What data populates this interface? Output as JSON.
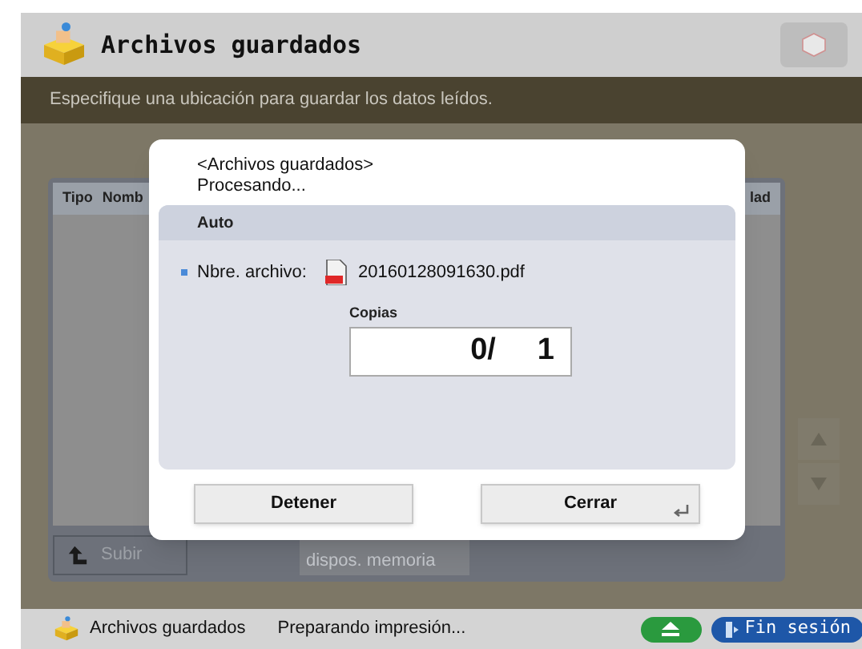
{
  "header": {
    "title": "Archivos guardados"
  },
  "instruction": "Especifique una ubicación para guardar los datos leídos.",
  "background": {
    "columns": [
      "Tipo",
      "Nomb",
      "lad"
    ],
    "up_button": "Subir",
    "memory_button": "dispos. memoria"
  },
  "dialog": {
    "title": "<Archivos guardados>",
    "status": "Procesando...",
    "section": "Auto",
    "file_label": "Nbre. archivo:",
    "file_name": "20160128091630.pdf",
    "copies_label": "Copias",
    "copies_done": "0/",
    "copies_total": "1",
    "buttons": [
      {
        "label": "Detener",
        "kind": "plain"
      },
      {
        "label": "Cerrar",
        "kind": "enter"
      }
    ]
  },
  "status_bar": {
    "app": "Archivos guardados",
    "message": "Preparando impresión...",
    "logout": "Fin sesión"
  }
}
